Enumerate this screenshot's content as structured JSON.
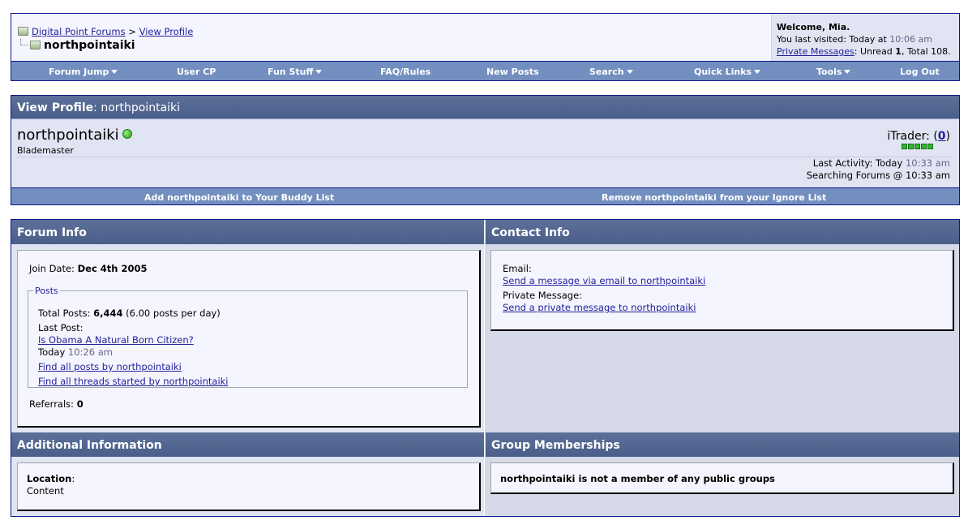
{
  "header": {
    "breadcrumb_root": "Digital Point Forums",
    "breadcrumb_sep": ">",
    "breadcrumb_current": "View Profile",
    "page_user": "northpointaiki"
  },
  "welcome": {
    "greeting": "Welcome, Mia.",
    "last_visited_label": "You last visited: Today at",
    "last_visited_time": "10:06 am",
    "pm_link": "Private Messages",
    "pm_text_unread": ": Unread ",
    "pm_unread": "1",
    "pm_text_total": ", Total 108."
  },
  "nav": {
    "items": [
      "Forum Jump",
      "User CP",
      "Fun Stuff",
      "FAQ/Rules",
      "New Posts",
      "Search",
      "Quick Links",
      "Tools",
      "Log Out"
    ]
  },
  "profile": {
    "header_label": "View Profile",
    "header_user": ": northpointaiki",
    "username": "northpointaiki",
    "user_title": "Blademaster",
    "itrader_label": "iTrader: (",
    "itrader_count": "0",
    "itrader_close": ")",
    "last_activity_label": "Last Activity: Today",
    "last_activity_time": "10:33 am",
    "current_location": "Searching Forums @ 10:33 am",
    "buddy_link": "Add northpointaiki to Your Buddy List",
    "ignore_link": "Remove northpointaiki from your Ignore List"
  },
  "forum_info": {
    "title": "Forum Info",
    "join_label": "Join Date: ",
    "join_date": "Dec 4th 2005",
    "posts_legend": "Posts",
    "total_posts_label": "Total Posts: ",
    "total_posts": "6,444",
    "posts_per_day": " (6.00 posts per day)",
    "last_post_label": "Last Post:",
    "last_post_title": "Is Obama A Natural Born Citizen?",
    "last_post_day": "Today ",
    "last_post_time": "10:26 am",
    "find_posts": "Find all posts by northpointaiki",
    "find_threads": "Find all threads started by northpointaiki",
    "referrals_label": "Referrals: ",
    "referrals": "0"
  },
  "contact_info": {
    "title": "Contact Info",
    "email_label": "Email:",
    "email_link": "Send a message via email to northpointaiki",
    "pm_label": "Private Message:",
    "pm_link": "Send a private message to northpointaiki"
  },
  "additional_info": {
    "title": "Additional Information",
    "location_label": "Location",
    "location_colon": ":",
    "location_value": "Content"
  },
  "groups": {
    "title": "Group Memberships",
    "message": "northpointaiki is not a member of any public groups"
  },
  "colors": {
    "nav_bg": "#738fbf",
    "header_bg": "#4a5e8a",
    "border": "#0b198c",
    "link": "#22229c",
    "online": "#2a9a1a"
  },
  "icons": [
    "folder-icon",
    "tree-line-icon",
    "dropdown-caret-icon",
    "online-status-icon",
    "itrader-bar-icon"
  ]
}
